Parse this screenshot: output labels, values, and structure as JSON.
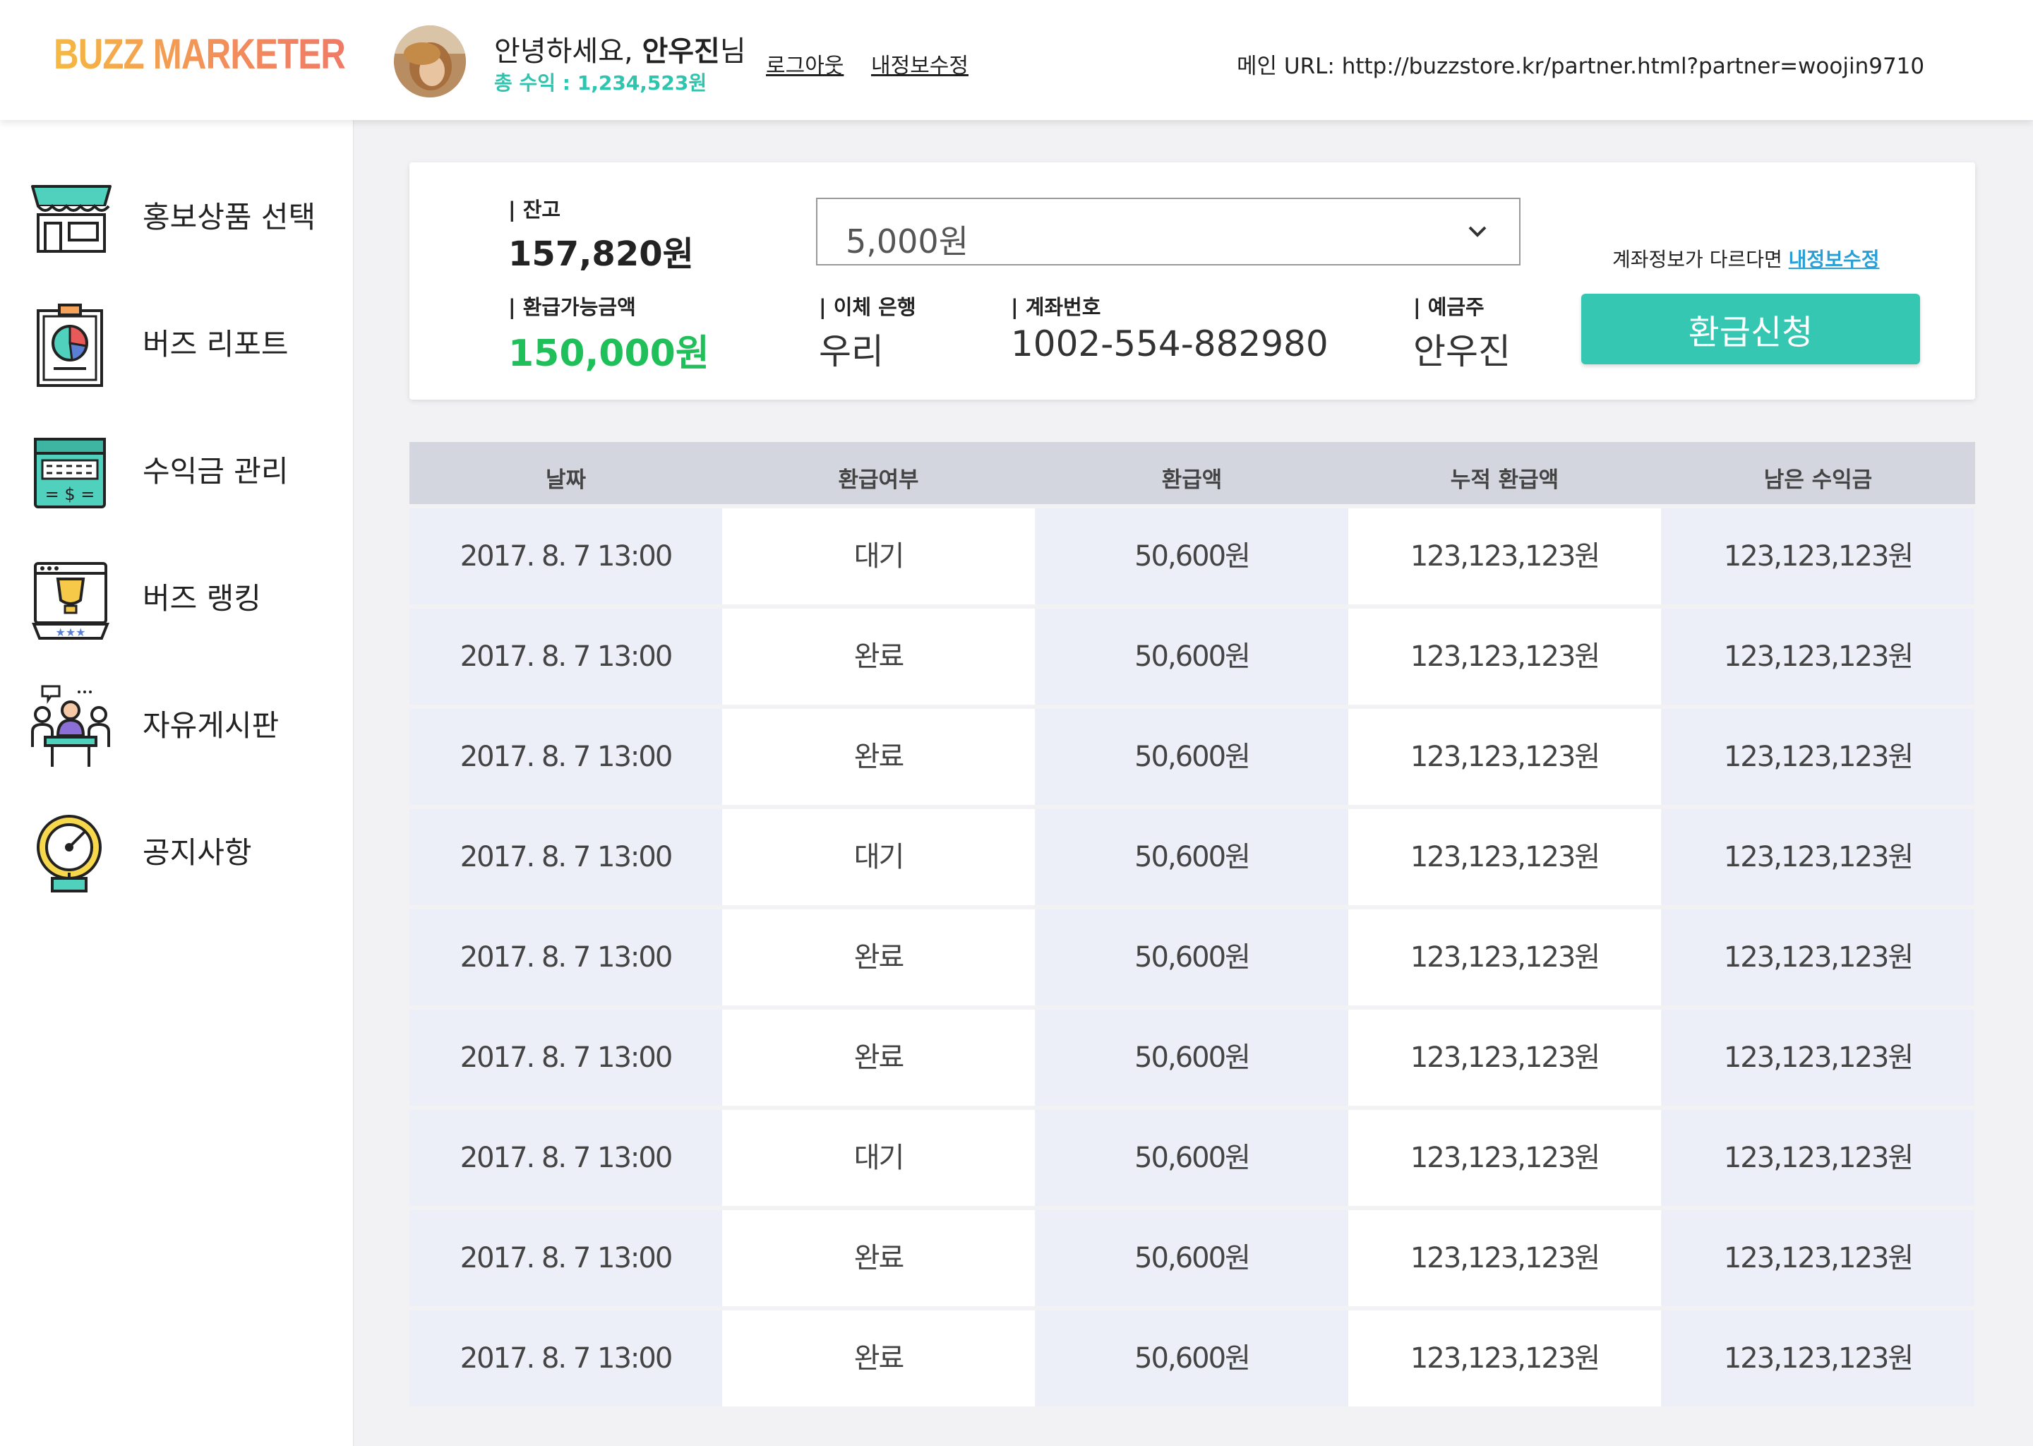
{
  "header": {
    "logo": "BUZZ MARKETER",
    "greeting_prefix": "안녕하세요, ",
    "user_name": "안우진",
    "greeting_suffix": "님",
    "total_earnings": "총 수익 : 1,234,523원",
    "logout": "로그아웃",
    "edit_profile": "내정보수정",
    "main_url": "메인 URL: http://buzzstore.kr/partner.html?partner=woojin9710"
  },
  "sidebar": {
    "items": [
      {
        "label": "홍보상품 선택",
        "icon": "store-icon"
      },
      {
        "label": "버즈 리포트",
        "icon": "report-icon"
      },
      {
        "label": "수익금 관리",
        "icon": "money-icon"
      },
      {
        "label": "버즈 랭킹",
        "icon": "trophy-icon"
      },
      {
        "label": "자유게시판",
        "icon": "meeting-icon"
      },
      {
        "label": "공지사항",
        "icon": "bell-icon"
      }
    ]
  },
  "summary": {
    "balance_label": "| 잔고",
    "balance": "157,820원",
    "refundable_label": "| 환급가능금액",
    "refundable": "150,000원",
    "amount_selected": "5,000원",
    "bank_label": "| 이체 은행",
    "bank": "우리",
    "account_label": "| 계좌번호",
    "account": "1002-554-882980",
    "holder_label": "| 예금주",
    "holder": "안우진",
    "hint": "계좌정보가 다르다면 ",
    "hint_link": "내정보수정",
    "refund_button": "환급신청"
  },
  "table": {
    "columns": [
      "날짜",
      "환급여부",
      "환급액",
      "누적 환급액",
      "남은 수익금"
    ],
    "rows": [
      [
        "2017. 8. 7 13:00",
        "대기",
        "50,600원",
        "123,123,123원",
        "123,123,123원"
      ],
      [
        "2017. 8. 7 13:00",
        "완료",
        "50,600원",
        "123,123,123원",
        "123,123,123원"
      ],
      [
        "2017. 8. 7 13:00",
        "완료",
        "50,600원",
        "123,123,123원",
        "123,123,123원"
      ],
      [
        "2017. 8. 7 13:00",
        "대기",
        "50,600원",
        "123,123,123원",
        "123,123,123원"
      ],
      [
        "2017. 8. 7 13:00",
        "완료",
        "50,600원",
        "123,123,123원",
        "123,123,123원"
      ],
      [
        "2017. 8. 7 13:00",
        "완료",
        "50,600원",
        "123,123,123원",
        "123,123,123원"
      ],
      [
        "2017. 8. 7 13:00",
        "대기",
        "50,600원",
        "123,123,123원",
        "123,123,123원"
      ],
      [
        "2017. 8. 7 13:00",
        "완료",
        "50,600원",
        "123,123,123원",
        "123,123,123원"
      ],
      [
        "2017. 8. 7 13:00",
        "완료",
        "50,600원",
        "123,123,123원",
        "123,123,123원"
      ]
    ]
  },
  "colors": {
    "accent": "#36c7b3",
    "refundable": "#1fbf5a",
    "earnings": "#2ec4ad",
    "link": "#2a9fd6",
    "table_header": "#d3d6df",
    "row_tint": "#eceef8"
  }
}
